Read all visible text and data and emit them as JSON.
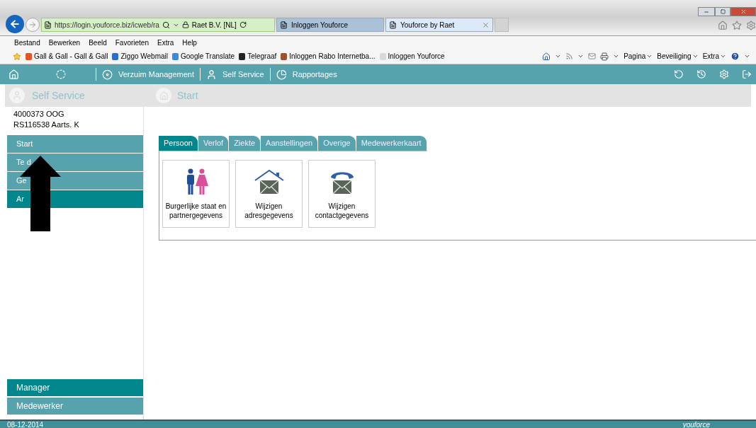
{
  "browser": {
    "address": "https://login.youforce.biz/icweb/ra",
    "security": "Raet B.V. [NL]",
    "tabs": [
      {
        "label": "Inloggen Youforce",
        "selected": false
      },
      {
        "label": "Youforce by Raet",
        "selected": true
      }
    ],
    "menu": [
      "Bestand",
      "Bewerken",
      "Beeld",
      "Favorieten",
      "Extra",
      "Help"
    ],
    "favorites": [
      "Gall & Gall - Gall & Gall",
      "Ziggo Webmail",
      "Google Translate",
      "Telegraaf",
      "Inloggen Rabo Internetba...",
      "Inloggen Youforce"
    ],
    "commands": [
      "Pagina",
      "Beveiliging",
      "Extra"
    ]
  },
  "app_nav": [
    "Verzuim Management",
    "Self Service",
    "Rapportages"
  ],
  "breadcrumb": [
    "Self Service",
    "Start"
  ],
  "user": [
    "4000373 OOG",
    "RS116538 Aarts. K"
  ],
  "sidebar": {
    "items": [
      {
        "label": "Start",
        "selected": false
      },
      {
        "label": "Te d",
        "selected": false
      },
      {
        "label": "Ge",
        "selected": false
      },
      {
        "label": "Ar",
        "selected": true
      }
    ],
    "bottom": [
      {
        "label": "Manager",
        "selected": true
      },
      {
        "label": "Medewerker",
        "selected": false
      }
    ]
  },
  "tabs": [
    {
      "label": "Persoon",
      "selected": true
    },
    {
      "label": "Verlof",
      "selected": false
    },
    {
      "label": "Ziekte",
      "selected": false
    },
    {
      "label": "Aanstellingen",
      "selected": false
    },
    {
      "label": "Overige",
      "selected": false
    },
    {
      "label": "Medewerkerkaart",
      "selected": false
    }
  ],
  "tiles": [
    {
      "kind": "people",
      "label": "Burgerlijke staat en partnergegevens"
    },
    {
      "kind": "address",
      "label": "Wijzigen adresgegevens"
    },
    {
      "kind": "contact",
      "label": "Wijzigen contactgegevens"
    }
  ],
  "status_bar": {
    "date": "08-12-2014",
    "brand": "youforce"
  }
}
